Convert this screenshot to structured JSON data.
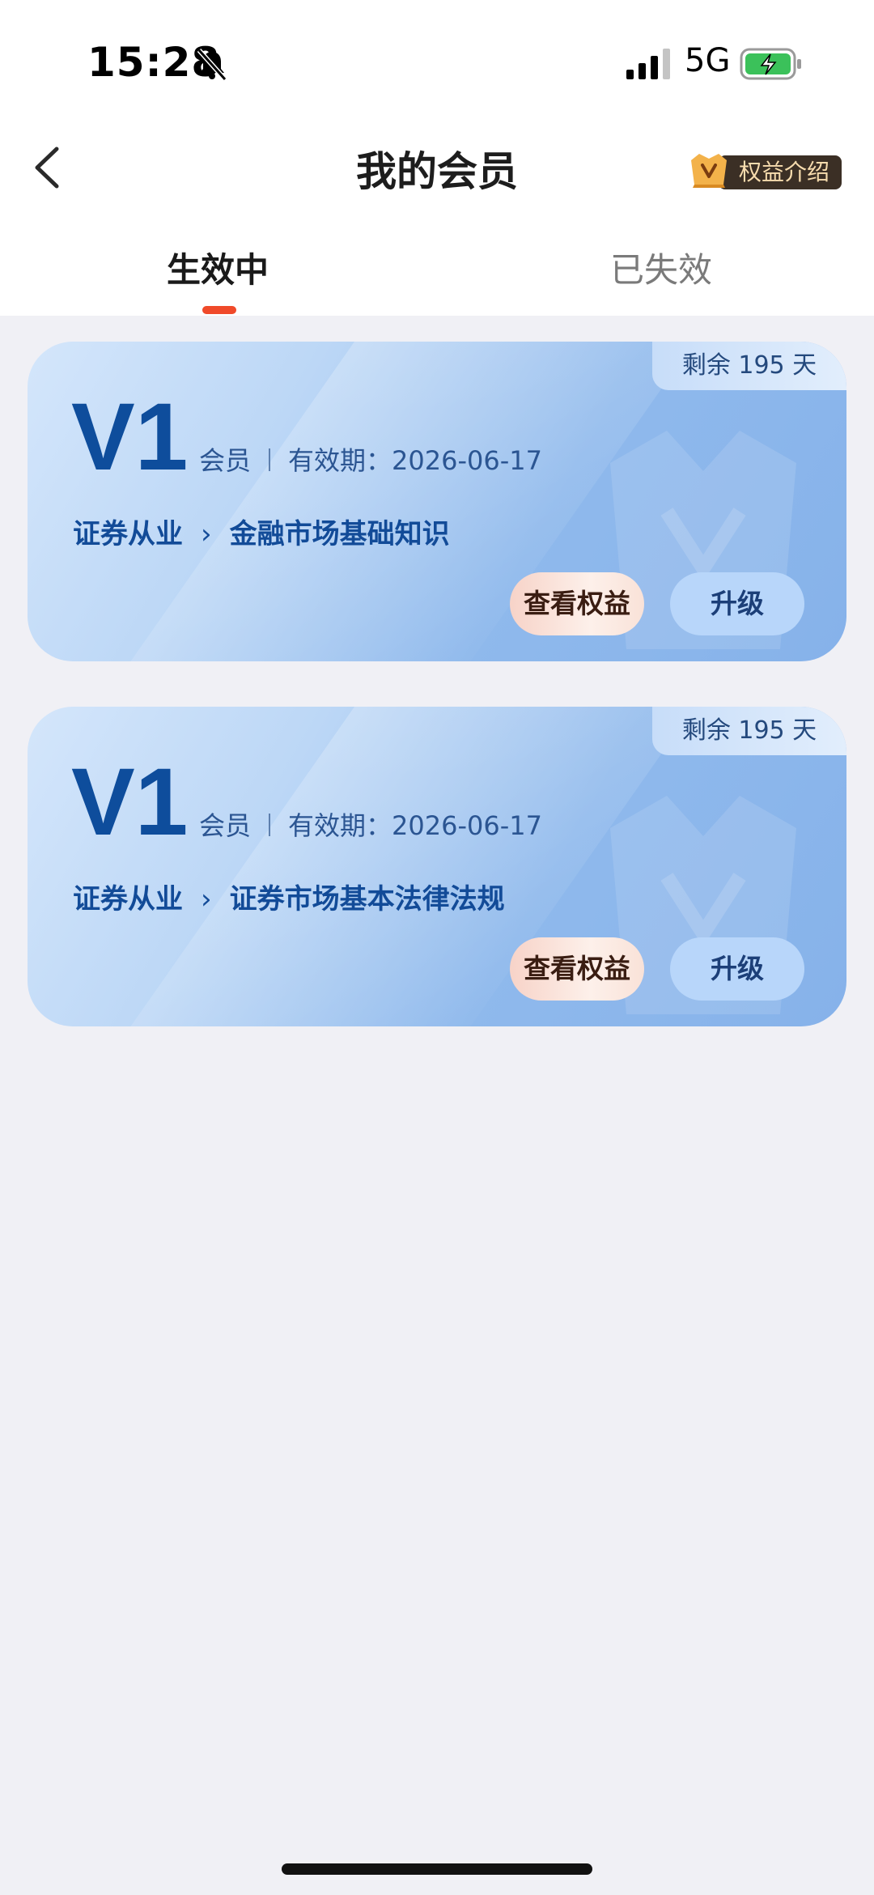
{
  "status_bar": {
    "time": "15:28",
    "network": "5G"
  },
  "nav": {
    "title": "我的会员",
    "intro_label": "权益介绍"
  },
  "tabs": [
    {
      "label": "生效中",
      "active": true
    },
    {
      "label": "已失效",
      "active": false
    }
  ],
  "memberships": [
    {
      "remaining": "剩余 195 天",
      "level": "V1",
      "type": "会员",
      "validity": "有效期：2026-06-17",
      "category": "证券从业",
      "subject": "金融市场基础知识",
      "view_rights": "查看权益",
      "upgrade": "升级"
    },
    {
      "remaining": "剩余 195 天",
      "level": "V1",
      "type": "会员",
      "validity": "有效期：2026-06-17",
      "category": "证券从业",
      "subject": "证券市场基本法律法规",
      "view_rights": "查看权益",
      "upgrade": "升级"
    }
  ],
  "colors": {
    "accent": "#f04a2a",
    "card_text": "#0e4d9c",
    "page_bg": "#f0f0f5"
  }
}
